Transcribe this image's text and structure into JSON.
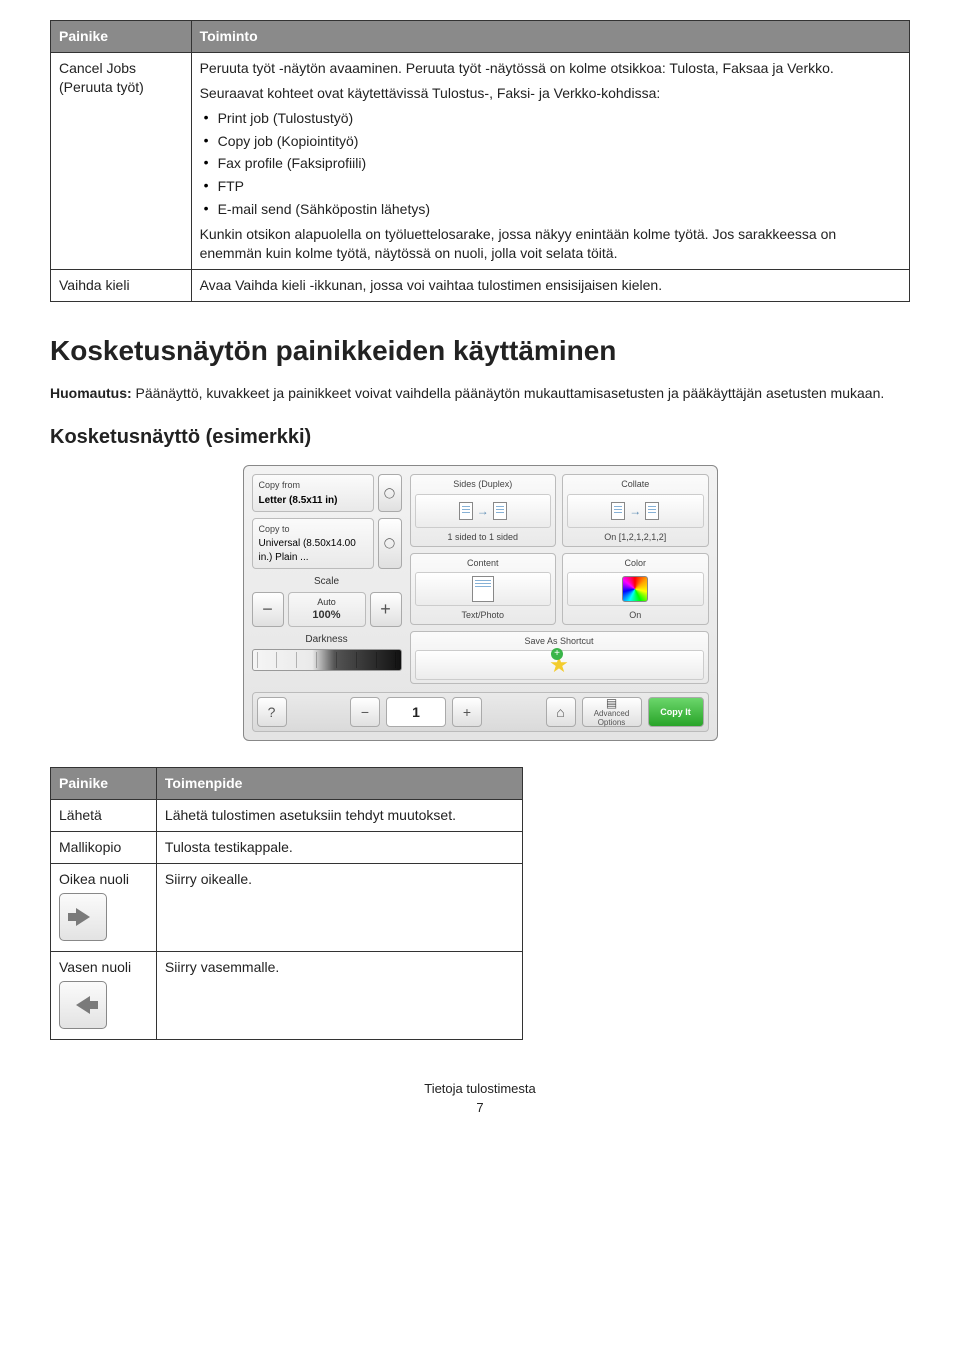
{
  "table1": {
    "headers": [
      "Painike",
      "Toiminto"
    ],
    "rows": [
      {
        "c0": "Cancel Jobs (Peruuta työt)",
        "para1": "Peruuta työt -näytön avaaminen. Peruuta työt -näytössä on kolme otsikkoa: Tulosta, Faksaa ja Verkko.",
        "para2": "Seuraavat kohteet ovat käytettävissä Tulostus-, Faksi- ja Verkko-kohdissa:",
        "bullets": [
          "Print job (Tulostustyö)",
          "Copy job (Kopiointityö)",
          "Fax profile (Faksiprofiili)",
          "FTP",
          "E-mail send (Sähköpostin lähetys)"
        ],
        "para3": "Kunkin otsikon alapuolella on työluettelosarake, jossa näkyy enintään kolme työtä. Jos sarakkeessa on enemmän kuin kolme työtä, näytössä on nuoli, jolla voit selata töitä."
      },
      {
        "c0": "Vaihda kieli",
        "c1": "Avaa Vaihda kieli -ikkunan, jossa voi vaihtaa tulostimen ensisijaisen kielen."
      }
    ]
  },
  "h1": "Kosketusnäytön painikkeiden käyttäminen",
  "note_label": "Huomautus:",
  "note_text": " Päänäyttö, kuvakkeet ja painikkeet voivat vaihdella päänäytön mukauttamisasetusten ja pääkäyttäjän asetusten mukaan.",
  "h2": "Kosketusnäyttö (esimerkki)",
  "ts": {
    "copy_from_lbl": "Copy from",
    "copy_from_val": "Letter (8.5x11 in)",
    "copy_to_lbl": "Copy to",
    "copy_to_val": "Universal (8.50x14.00 in.) Plain ...",
    "scale_lbl": "Scale",
    "scale_auto": "Auto",
    "scale_val": "100%",
    "darkness_lbl": "Darkness",
    "sides_lbl": "Sides (Duplex)",
    "sides_val": "1 sided to 1 sided",
    "collate_lbl": "Collate",
    "collate_val": "On [1,2,1,2,1,2]",
    "content_lbl": "Content",
    "content_val": "Text/Photo",
    "color_lbl": "Color",
    "color_val": "On",
    "save_lbl": "Save As Shortcut",
    "copies_val": "1",
    "advopt1": "Advanced",
    "advopt2": "Options",
    "copyit": "Copy It"
  },
  "table2": {
    "headers": [
      "Painike",
      "Toimenpide"
    ],
    "rows": [
      {
        "c0": "Lähetä",
        "c1": "Lähetä tulostimen asetuksiin tehdyt muutokset."
      },
      {
        "c0": "Mallikopio",
        "c1": "Tulosta testikappale."
      },
      {
        "c0": "Oikea nuoli",
        "c1": "Siirry oikealle.",
        "icon": "right"
      },
      {
        "c0": "Vasen nuoli",
        "c1": "Siirry vasemmalle.",
        "icon": "left"
      }
    ]
  },
  "footer_title": "Tietoja tulostimesta",
  "footer_page": "7"
}
